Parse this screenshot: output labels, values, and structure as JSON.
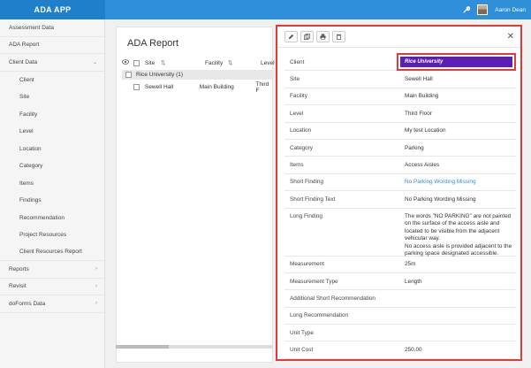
{
  "app": {
    "title": "ADA APP",
    "user_name": "Aaron Dean"
  },
  "sidebar": {
    "items": [
      {
        "label": "Assessment Data",
        "chevron": ""
      },
      {
        "label": "ADA Report",
        "chevron": ""
      },
      {
        "label": "Client Data",
        "chevron": "⌄"
      },
      {
        "label": "Client",
        "sub": true
      },
      {
        "label": "Site",
        "sub": true
      },
      {
        "label": "Facility",
        "sub": true
      },
      {
        "label": "Level",
        "sub": true
      },
      {
        "label": "Location",
        "sub": true
      },
      {
        "label": "Category",
        "sub": true
      },
      {
        "label": "Items",
        "sub": true
      },
      {
        "label": "Findings",
        "sub": true
      },
      {
        "label": "Recommendation",
        "sub": true
      },
      {
        "label": "Project Resources",
        "sub": true
      },
      {
        "label": "Client Resources Report",
        "sub": true
      },
      {
        "label": "Reports",
        "chevron": "›"
      },
      {
        "label": "Revisit",
        "chevron": "›"
      },
      {
        "label": "doForms Data",
        "chevron": "›"
      }
    ]
  },
  "main": {
    "title": "ADA Report",
    "columns": [
      "Site",
      "Facility",
      "Level"
    ],
    "group_label": "Rice University (1)",
    "row": {
      "site": "Sewell Hall",
      "facility": "Main Building",
      "level": "Third F"
    }
  },
  "detail": {
    "rows": [
      {
        "label": "Client",
        "value": "Rice University"
      },
      {
        "label": "Site",
        "value": "Sewell Hall"
      },
      {
        "label": "Facility",
        "value": "Main Building"
      },
      {
        "label": "Level",
        "value": "Third Floor"
      },
      {
        "label": "Location",
        "value": "My test Location"
      },
      {
        "label": "Category",
        "value": "Parking"
      },
      {
        "label": "Items",
        "value": "Access Aisles"
      },
      {
        "label": "Short Finding",
        "value": "No Parking Wording Missing"
      },
      {
        "label": "Short Finding Text",
        "value": "No Parking Wording Missing"
      },
      {
        "label": "Long Finding",
        "value_lines": [
          "The words \"NO PARKING\" are not painted",
          "on the surface of the access aisle and",
          "located to be visible from the adjacent",
          "vehicular way.",
          "No access aisle is provided adjacent to the",
          "parking space designated accessible."
        ]
      },
      {
        "label": "Measurement",
        "value": "25m"
      },
      {
        "label": "Measurement Type",
        "value": "Length"
      },
      {
        "label": "Additional Short Recommendation",
        "value": ""
      },
      {
        "label": "Long Recommendation",
        "value": ""
      },
      {
        "label": "Unit Type",
        "value": ""
      },
      {
        "label": "Unit Cost",
        "value": "250.00"
      }
    ]
  },
  "colors": {
    "topbar": "#2f8fd8",
    "client_chip": "#5b1fb5",
    "highlight_border": "#e53935",
    "link": "#2f8fd8"
  },
  "icons": [
    "wrench-icon",
    "avatar",
    "eye-icon",
    "pencil-icon",
    "copy-icon",
    "print-icon",
    "trash-icon",
    "close-icon"
  ]
}
